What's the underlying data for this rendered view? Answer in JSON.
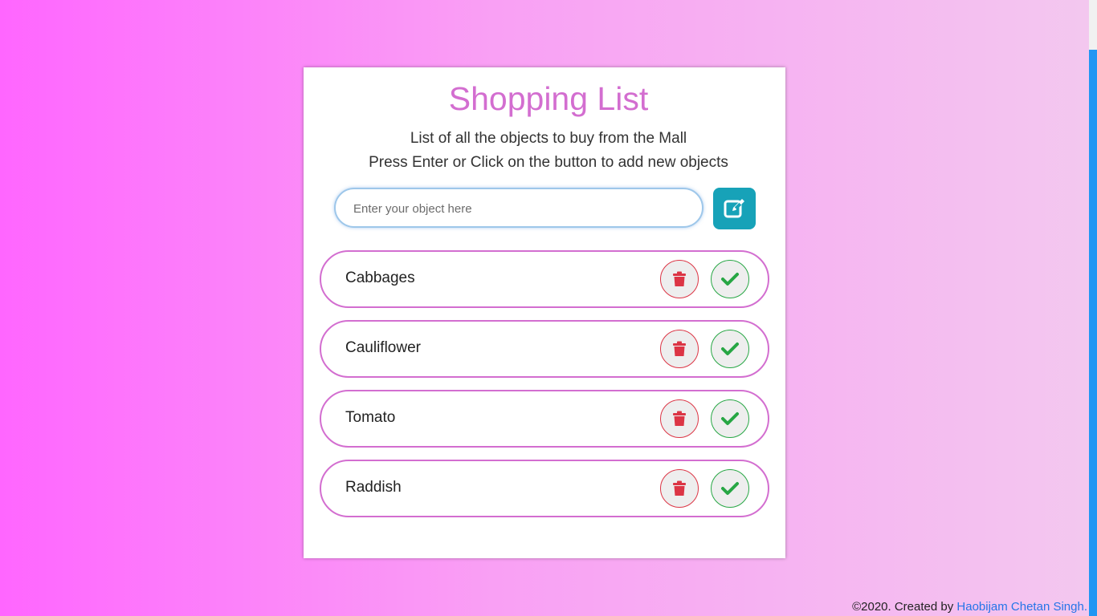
{
  "header": {
    "title": "Shopping List",
    "subtitle_line1": "List of all the objects to buy from the Mall",
    "subtitle_line2": "Press Enter or Click on the button to add new objects"
  },
  "input": {
    "placeholder": "Enter your object here",
    "value": ""
  },
  "add_button": {
    "icon": "edit-icon",
    "color": "#17a2b8"
  },
  "items": [
    {
      "label": "Cabbages"
    },
    {
      "label": "Cauliflower"
    },
    {
      "label": "Tomato"
    },
    {
      "label": "Raddish"
    }
  ],
  "item_actions": {
    "delete_icon": "trash-icon",
    "done_icon": "check-icon",
    "delete_color": "#dc3545",
    "done_color": "#28a745"
  },
  "footer": {
    "text": "©2020. Created by ",
    "author": "Haobijam Chetan Singh."
  },
  "colors": {
    "accent": "#d36ed0",
    "background_left": "#ff66ff",
    "background_right": "#f3c8ef"
  }
}
